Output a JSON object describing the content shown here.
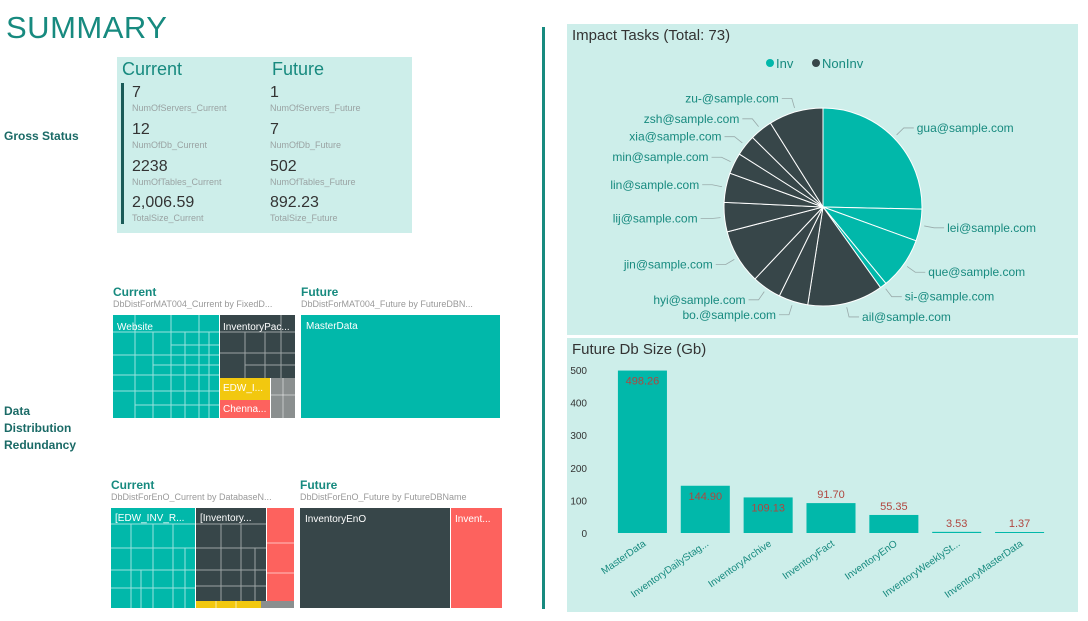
{
  "title": "SUMMARY",
  "gross_status": {
    "label": "Gross Status",
    "current_header": "Current",
    "future_header": "Future",
    "metrics": [
      {
        "current_value": "7",
        "current_label": "NumOfServers_Current",
        "future_value": "1",
        "future_label": "NumOfServers_Future"
      },
      {
        "current_value": "12",
        "current_label": "NumOfDb_Current",
        "future_value": "7",
        "future_label": "NumOfDb_Future"
      },
      {
        "current_value": "2238",
        "current_label": "NumOfTables_Current",
        "future_value": "502",
        "future_label": "NumOfTables_Future"
      },
      {
        "current_value": "2,006.59",
        "current_label": "TotalSize_Current",
        "future_value": "892.23",
        "future_label": "TotalSize_Future"
      }
    ]
  },
  "data_distribution": {
    "label_lines": [
      "Data",
      "Distribution",
      "Redundancy"
    ],
    "mat004_current": {
      "title": "Current",
      "subtitle": "DbDistForMAT004_Current by FixedD...",
      "labels": [
        "Website",
        "InventoryPac...",
        "EDW_I...",
        "Chenna..."
      ]
    },
    "mat004_future": {
      "title": "Future",
      "subtitle": "DbDistForMAT004_Future by FutureDBN...",
      "labels": [
        "MasterData"
      ]
    },
    "eno_current": {
      "title": "Current",
      "subtitle": "DbDistForEnO_Current by DatabaseN...",
      "labels": [
        "[EDW_INV_R...",
        "[Inventory..."
      ]
    },
    "eno_future": {
      "title": "Future",
      "subtitle": "DbDistForEnO_Future by FutureDBName",
      "labels": [
        "InventoryEnO",
        "Invent..."
      ]
    }
  },
  "colors": {
    "teal": "#01b8aa",
    "dark": "#374649",
    "red": "#fd625e",
    "yellow": "#f2c80f",
    "gray": "#8a8f8f",
    "panel_bg": "#cdeeea",
    "label_value_red": "#b0463f"
  },
  "impact_tasks": {
    "title": "Impact Tasks (Total: 73)",
    "legend": [
      {
        "name": "Inv",
        "color": "#01b8aa"
      },
      {
        "name": "NonInv",
        "color": "#374649"
      }
    ],
    "chart_data": {
      "type": "pie",
      "total": 73,
      "slices": [
        {
          "label": "gua@sample.com",
          "value": 18.5,
          "group": "Inv"
        },
        {
          "label": "lei@sample.com",
          "value": 3.8,
          "group": "Inv"
        },
        {
          "label": "que@sample.com",
          "value": 6.2,
          "group": "Inv"
        },
        {
          "label": "si-@sample.com",
          "value": 0.8,
          "group": "Inv"
        },
        {
          "label": "ail@sample.com",
          "value": 9.0,
          "group": "NonInv"
        },
        {
          "label": "bo.@sample.com",
          "value": 3.5,
          "group": "NonInv"
        },
        {
          "label": "hyi@sample.com",
          "value": 3.5,
          "group": "NonInv"
        },
        {
          "label": "jin@sample.com",
          "value": 6.5,
          "group": "NonInv"
        },
        {
          "label": "lij@sample.com",
          "value": 3.5,
          "group": "NonInv"
        },
        {
          "label": "lin@sample.com",
          "value": 3.5,
          "group": "NonInv"
        },
        {
          "label": "min@sample.com",
          "value": 2.5,
          "group": "NonInv"
        },
        {
          "label": "xia@sample.com",
          "value": 2.5,
          "group": "NonInv"
        },
        {
          "label": "zsh@sample.com",
          "value": 2.7,
          "group": "NonInv"
        },
        {
          "label": "zu-@sample.com",
          "value": 6.5,
          "group": "NonInv"
        }
      ]
    }
  },
  "future_db_size": {
    "title": "Future Db Size (Gb)",
    "chart_data": {
      "type": "bar",
      "categories": [
        "MasterData",
        "InventoryDailyStag...",
        "InventoryArchive",
        "InventoryFact",
        "InventoryEnO",
        "InventoryWeeklySt...",
        "InventoryMasterData"
      ],
      "values": [
        498.26,
        144.9,
        109.13,
        91.7,
        55.35,
        3.53,
        1.37
      ],
      "value_labels": [
        "498.26",
        "144.90",
        "109.13",
        "91.70",
        "55.35",
        "3.53",
        "1.37"
      ],
      "ylim": [
        0,
        500
      ],
      "yticks": [
        "0",
        "100",
        "200",
        "300",
        "400",
        "500"
      ],
      "bar_color": "#01b8aa"
    }
  }
}
